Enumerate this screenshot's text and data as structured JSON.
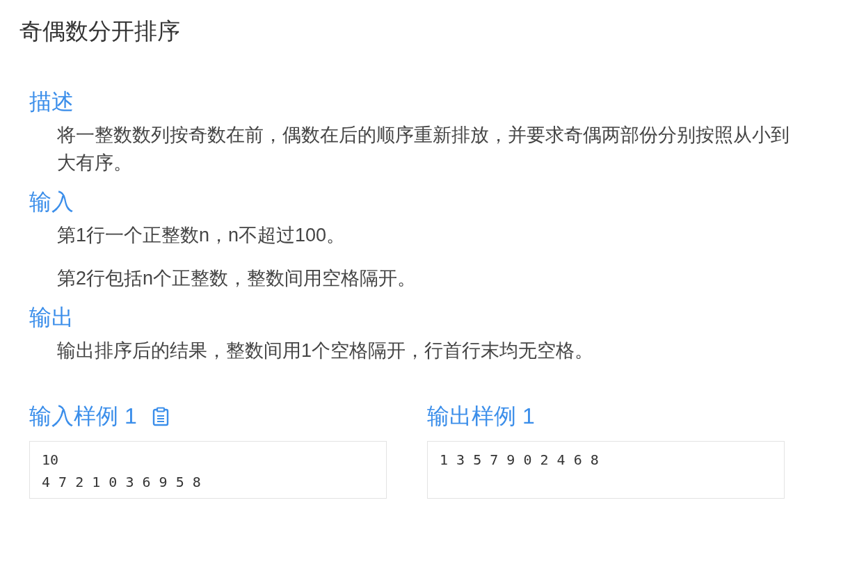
{
  "title": "奇偶数分开排序",
  "sections": [
    {
      "heading": "描述",
      "paragraphs": [
        "将一整数数列按奇数在前，偶数在后的顺序重新排放，并要求奇偶两部份分别按照从小到大有序。"
      ]
    },
    {
      "heading": "输入",
      "paragraphs": [
        "第1行一个正整数n，n不超过100。",
        "第2行包括n个正整数，整数间用空格隔开。"
      ]
    },
    {
      "heading": "输出",
      "paragraphs": [
        "输出排序后的结果，整数间用1个空格隔开，行首行末均无空格。"
      ]
    }
  ],
  "samples": [
    {
      "heading": "输入样例 1",
      "copy_button": true,
      "lines": [
        "10",
        "4 7 2 1 0 3 6 9 5 8"
      ]
    },
    {
      "heading": "输出样例 1",
      "copy_button": false,
      "lines": [
        "1 3 5 7 9 0 2 4 6 8"
      ]
    }
  ]
}
